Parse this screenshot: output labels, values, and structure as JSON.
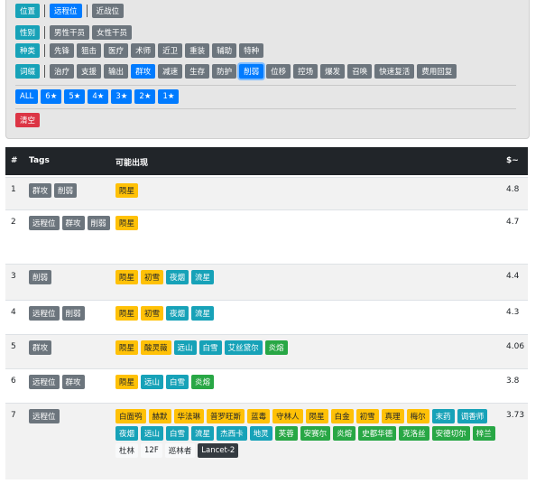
{
  "filters": {
    "position": {
      "label": "位置",
      "options": [
        "远程位",
        "近战位"
      ]
    },
    "gender": {
      "label": "性别",
      "options": [
        "男性干员",
        "女性干员"
      ]
    },
    "class": {
      "label": "种类",
      "options": [
        "先锋",
        "狙击",
        "医疗",
        "术师",
        "近卫",
        "重装",
        "辅助",
        "特种"
      ]
    },
    "affix": {
      "label": "词缀",
      "options": [
        "治疗",
        "支援",
        "输出",
        "群攻",
        "减速",
        "生存",
        "防护",
        "削弱",
        "位移",
        "控场",
        "爆发",
        "召唤",
        "快速复活",
        "费用回复"
      ]
    },
    "stars": [
      "ALL",
      "6★",
      "5★",
      "4★",
      "3★",
      "2★",
      "1★"
    ],
    "clear": "清空"
  },
  "table": {
    "headers": {
      "num": "#",
      "tags": "Tags",
      "results": "可能出现",
      "value": "$~"
    },
    "rows": [
      {
        "num": "1",
        "tags": [
          "群攻",
          "削弱"
        ],
        "results": [
          {
            "t": "陨星",
            "c": "warn"
          }
        ],
        "value": "4.8"
      },
      {
        "num": "2",
        "tags": [
          "远程位",
          "群攻",
          "削弱"
        ],
        "results": [
          {
            "t": "陨星",
            "c": "warn"
          }
        ],
        "value": "4.7"
      },
      {
        "num": "3",
        "tags": [
          "削弱"
        ],
        "results": [
          {
            "t": "陨星",
            "c": "warn"
          },
          {
            "t": "初雪",
            "c": "warn"
          },
          {
            "t": "夜烟",
            "c": "info"
          },
          {
            "t": "流星",
            "c": "info"
          }
        ],
        "value": "4.4"
      },
      {
        "num": "4",
        "tags": [
          "远程位",
          "削弱"
        ],
        "results": [
          {
            "t": "陨星",
            "c": "warn"
          },
          {
            "t": "初雪",
            "c": "warn"
          },
          {
            "t": "夜烟",
            "c": "info"
          },
          {
            "t": "流星",
            "c": "info"
          }
        ],
        "value": "4.3"
      },
      {
        "num": "5",
        "tags": [
          "群攻"
        ],
        "results": [
          {
            "t": "陨星",
            "c": "warn"
          },
          {
            "t": "酸灵薇",
            "c": "warn"
          },
          {
            "t": "远山",
            "c": "info"
          },
          {
            "t": "白雪",
            "c": "info"
          },
          {
            "t": "艾丝黛尔",
            "c": "info"
          },
          {
            "t": "炎熔",
            "c": "succ"
          }
        ],
        "value": "4.06"
      },
      {
        "num": "6",
        "tags": [
          "远程位",
          "群攻"
        ],
        "results": [
          {
            "t": "陨星",
            "c": "warn"
          },
          {
            "t": "远山",
            "c": "info"
          },
          {
            "t": "白雪",
            "c": "info"
          },
          {
            "t": "炎熔",
            "c": "succ"
          }
        ],
        "value": "3.8"
      },
      {
        "num": "7",
        "tags": [
          "远程位"
        ],
        "results": [
          {
            "t": "白面鸮",
            "c": "warn"
          },
          {
            "t": "赫默",
            "c": "warn"
          },
          {
            "t": "华法琳",
            "c": "warn"
          },
          {
            "t": "普罗旺斯",
            "c": "warn"
          },
          {
            "t": "蓝毒",
            "c": "warn"
          },
          {
            "t": "守林人",
            "c": "warn"
          },
          {
            "t": "陨星",
            "c": "warn"
          },
          {
            "t": "白金",
            "c": "warn"
          },
          {
            "t": "初雪",
            "c": "warn"
          },
          {
            "t": "真理",
            "c": "warn"
          },
          {
            "t": "梅尔",
            "c": "warn"
          },
          {
            "t": "末药",
            "c": "info"
          },
          {
            "t": "调香师",
            "c": "info"
          },
          {
            "t": "夜烟",
            "c": "info"
          },
          {
            "t": "远山",
            "c": "info"
          },
          {
            "t": "白雪",
            "c": "info"
          },
          {
            "t": "流星",
            "c": "info"
          },
          {
            "t": "杰西卡",
            "c": "info"
          },
          {
            "t": "地灵",
            "c": "info"
          },
          {
            "t": "芙蓉",
            "c": "succ"
          },
          {
            "t": "安赛尔",
            "c": "succ"
          },
          {
            "t": "炎熔",
            "c": "succ"
          },
          {
            "t": "史都华德",
            "c": "succ"
          },
          {
            "t": "克洛丝",
            "c": "succ"
          },
          {
            "t": "安德切尔",
            "c": "succ"
          },
          {
            "t": "梓兰",
            "c": "succ"
          },
          {
            "t": "杜林",
            "c": "light"
          },
          {
            "t": "12F",
            "c": "light"
          },
          {
            "t": "巡林者",
            "c": "light"
          },
          {
            "t": "Lancet-2",
            "c": "dark"
          }
        ],
        "value": "3.73"
      }
    ]
  }
}
